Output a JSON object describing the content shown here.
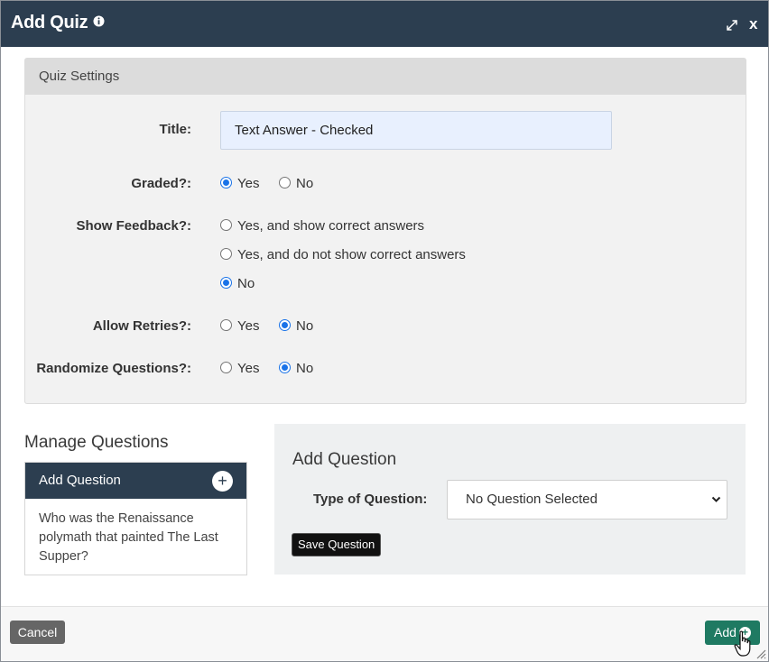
{
  "dialog": {
    "title": "Add Quiz",
    "close_label": "x"
  },
  "settings": {
    "header": "Quiz Settings",
    "title_label": "Title:",
    "title_value": "Text Answer  - Checked",
    "graded": {
      "label": "Graded?:",
      "options": [
        "Yes",
        "No"
      ],
      "selected": "Yes"
    },
    "show_feedback": {
      "label": "Show Feedback?:",
      "options": [
        "Yes, and show correct answers",
        "Yes, and do not show correct answers",
        "No"
      ],
      "selected": "No"
    },
    "allow_retries": {
      "label": "Allow Retries?:",
      "options": [
        "Yes",
        "No"
      ],
      "selected": "No"
    },
    "randomize": {
      "label": "Randomize Questions?:",
      "options": [
        "Yes",
        "No"
      ],
      "selected": "No"
    }
  },
  "manage": {
    "title": "Manage Questions",
    "card_header": "Add Question",
    "card_plus": "+",
    "question_text": "Who was the Renaissance polymath that painted The Last Supper?"
  },
  "add_question": {
    "title": "Add Question",
    "type_label": "Type of Question:",
    "type_value": "No Question Selected",
    "save_label": "Save Question"
  },
  "footer": {
    "cancel_label": "Cancel",
    "add_label": "Add"
  },
  "colors": {
    "header_bg": "#2c3e50",
    "add_button": "#1f7a62",
    "radio_selected": "#1a73e8",
    "input_bg": "#e8f0fe"
  }
}
